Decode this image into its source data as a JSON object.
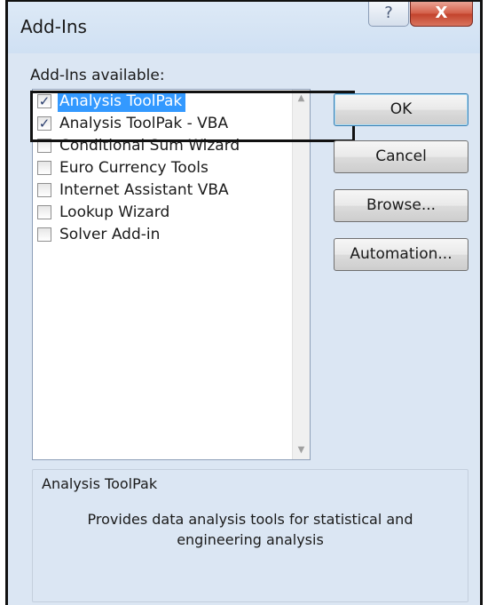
{
  "dialog": {
    "title": "Add-Ins",
    "help_glyph": "?",
    "close_glyph": "X"
  },
  "list": {
    "label": "Add-Ins available:",
    "items": [
      {
        "label": "Analysis ToolPak",
        "checked": true,
        "selected": true
      },
      {
        "label": "Analysis ToolPak - VBA",
        "checked": true,
        "selected": false
      },
      {
        "label": "Conditional Sum Wizard",
        "checked": false,
        "selected": false
      },
      {
        "label": "Euro Currency Tools",
        "checked": false,
        "selected": false
      },
      {
        "label": "Internet Assistant VBA",
        "checked": false,
        "selected": false
      },
      {
        "label": "Lookup Wizard",
        "checked": false,
        "selected": false
      },
      {
        "label": "Solver Add-in",
        "checked": false,
        "selected": false
      }
    ],
    "check_glyph": "✓",
    "scroll_up_icon": "▲",
    "scroll_down_icon": "▼"
  },
  "buttons": {
    "ok": "OK",
    "cancel": "Cancel",
    "browse": "Browse...",
    "automation": "Automation..."
  },
  "description": {
    "title": "Analysis ToolPak",
    "text": "Provides data analysis tools for statistical and engineering analysis"
  },
  "colors": {
    "selection": "#3399ff",
    "dialog_bg": "#dbe6f3",
    "close_button": "#c2422b"
  }
}
